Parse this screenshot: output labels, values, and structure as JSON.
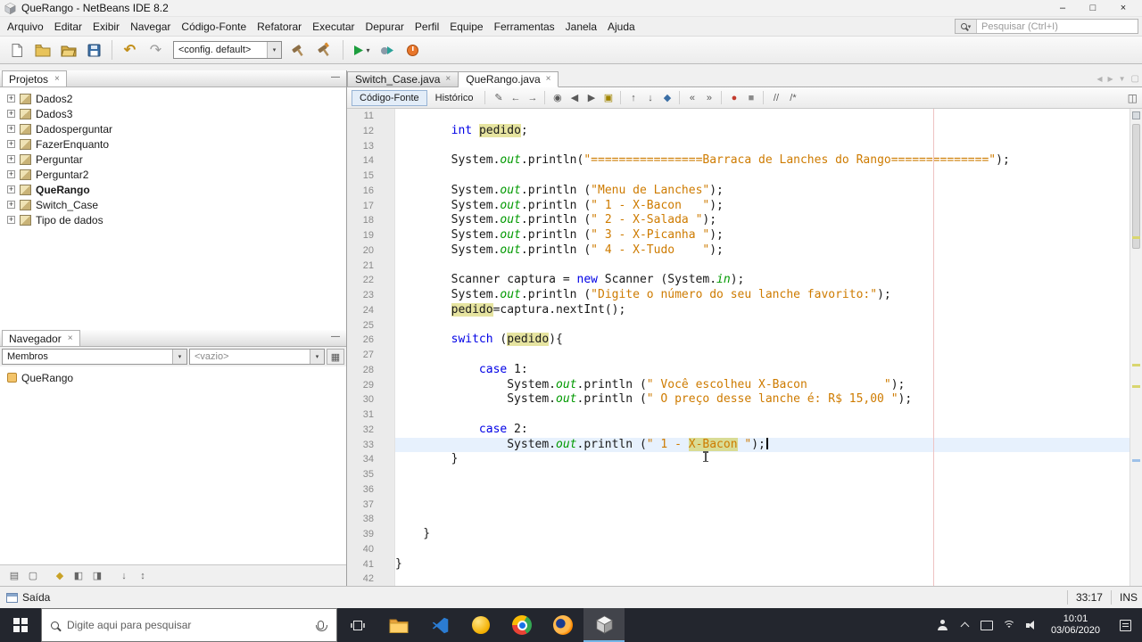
{
  "window": {
    "title": "QueRango - NetBeans IDE 8.2",
    "minimize_glyph": "–",
    "maximize_glyph": "□",
    "close_glyph": "×"
  },
  "icons": {
    "plus": "+",
    "close": "×",
    "minimize_panel": "—",
    "dropdown": "▾",
    "grid": "▦",
    "tab_prev": "◀",
    "tab_next": "▶",
    "tab_list": "▼",
    "tab_max": "▢",
    "undo": "↶",
    "redo": "↷",
    "split": "◫"
  },
  "menubar": [
    "Arquivo",
    "Editar",
    "Exibir",
    "Navegar",
    "Código-Fonte",
    "Refatorar",
    "Executar",
    "Depurar",
    "Perfil",
    "Equipe",
    "Ferramentas",
    "Janela",
    "Ajuda"
  ],
  "quick_search": {
    "placeholder": "Pesquisar (Ctrl+I)"
  },
  "toolbar": {
    "config_value": "<config. default>"
  },
  "projects_panel": {
    "title": "Projetos",
    "items": [
      "Dados2",
      "Dados3",
      "Dadosperguntar",
      "FazerEnquanto",
      "Perguntar",
      "Perguntar2",
      "QueRango",
      "Switch_Case",
      "Tipo de dados"
    ],
    "main_project": "QueRango"
  },
  "navigator_panel": {
    "title": "Navegador",
    "view_value": "Membros",
    "filter_value": "<vazio>",
    "items": [
      "QueRango"
    ],
    "filter_icons": [
      {
        "n": "open-documents-icon",
        "g": "▤"
      },
      {
        "n": "editor-members-icon",
        "g": "▢"
      },
      {
        "sep": true
      },
      {
        "n": "show-inherited-members-icon",
        "g": "◆",
        "c": "#c9a227"
      },
      {
        "n": "show-fields-icon",
        "g": "◧"
      },
      {
        "n": "show-static-members-icon",
        "g": "◨"
      },
      {
        "sep": true
      },
      {
        "n": "sort-by-name-icon",
        "g": "↓"
      },
      {
        "n": "sort-by-source-icon",
        "g": "↕"
      }
    ]
  },
  "editor": {
    "tabs": [
      {
        "label": "Switch_Case.java",
        "active": false
      },
      {
        "label": "QueRango.java",
        "active": true
      }
    ],
    "toolbar": {
      "source_label": "Código-Fonte",
      "history_label": "Histórico",
      "icons": [
        {
          "n": "last-edited-icon",
          "g": "✎"
        },
        {
          "n": "back-icon",
          "g": "←"
        },
        {
          "n": "forward-icon",
          "g": "→"
        },
        {
          "sep": true
        },
        {
          "n": "find-selection-icon",
          "g": "◉"
        },
        {
          "n": "find-previous-occurrence-icon",
          "g": "◀"
        },
        {
          "n": "find-next-occurrence-icon",
          "g": "▶"
        },
        {
          "n": "toggle-highlight-search-icon",
          "g": "▣",
          "c": "#a08400"
        },
        {
          "sep": true
        },
        {
          "n": "previous-bookmark-icon",
          "g": "↑"
        },
        {
          "n": "next-bookmark-icon",
          "g": "↓"
        },
        {
          "n": "toggle-bookmark-icon",
          "g": "◆",
          "c": "#3a6ea5"
        },
        {
          "sep": true
        },
        {
          "n": "shift-left-icon",
          "g": "«"
        },
        {
          "n": "shift-right-icon",
          "g": "»"
        },
        {
          "sep": true
        },
        {
          "n": "start-macro-recording-icon",
          "g": "●",
          "c": "#c23b2e"
        },
        {
          "n": "stop-macro-recording-icon",
          "g": "■",
          "c": "#8a8a8a"
        },
        {
          "sep": true
        },
        {
          "n": "comment-lines-icon",
          "g": "//"
        },
        {
          "n": "uncomment-lines-icon",
          "g": "/*"
        }
      ]
    },
    "first_line_number": 11,
    "current_line": 33,
    "lines": [
      [],
      [
        [
          "",
          "        "
        ],
        [
          "k",
          "int"
        ],
        [
          "",
          " "
        ],
        [
          "o",
          "pedido"
        ],
        [
          "",
          ";"
        ]
      ],
      [],
      [
        [
          "",
          "        System."
        ],
        [
          "f",
          "out"
        ],
        [
          "",
          ".println("
        ],
        [
          "s",
          "\"================Barraca de Lanches do Rango==============\""
        ],
        [
          "",
          ");"
        ]
      ],
      [],
      [
        [
          "",
          "        System."
        ],
        [
          "f",
          "out"
        ],
        [
          "",
          ".println ("
        ],
        [
          "s",
          "\"Menu de Lanches\""
        ],
        [
          "",
          ");"
        ]
      ],
      [
        [
          "",
          "        System."
        ],
        [
          "f",
          "out"
        ],
        [
          "",
          ".println ("
        ],
        [
          "s",
          "\" 1 - X-Bacon   \""
        ],
        [
          "",
          ");"
        ]
      ],
      [
        [
          "",
          "        System."
        ],
        [
          "f",
          "out"
        ],
        [
          "",
          ".println ("
        ],
        [
          "s",
          "\" 2 - X-Salada \""
        ],
        [
          "",
          ");"
        ]
      ],
      [
        [
          "",
          "        System."
        ],
        [
          "f",
          "out"
        ],
        [
          "",
          ".println ("
        ],
        [
          "s",
          "\" 3 - X-Picanha \""
        ],
        [
          "",
          ");"
        ]
      ],
      [
        [
          "",
          "        System."
        ],
        [
          "f",
          "out"
        ],
        [
          "",
          ".println ("
        ],
        [
          "s",
          "\" 4 - X-Tudo    \""
        ],
        [
          "",
          ");"
        ]
      ],
      [],
      [
        [
          "",
          "        Scanner captura = "
        ],
        [
          "k",
          "new"
        ],
        [
          "",
          " Scanner (System."
        ],
        [
          "f",
          "in"
        ],
        [
          "",
          ");"
        ]
      ],
      [
        [
          "",
          "        System."
        ],
        [
          "f",
          "out"
        ],
        [
          "",
          ".println ("
        ],
        [
          "s",
          "\"Digite o número do seu lanche favorito:\""
        ],
        [
          "",
          ");"
        ]
      ],
      [
        [
          "",
          "        "
        ],
        [
          "o",
          "pedido"
        ],
        [
          "",
          "=captura.nextInt();"
        ]
      ],
      [],
      [
        [
          "",
          "        "
        ],
        [
          "k",
          "switch"
        ],
        [
          "",
          " ("
        ],
        [
          "o",
          "pedido"
        ],
        [
          "",
          "){"
        ]
      ],
      [],
      [
        [
          "",
          "            "
        ],
        [
          "k",
          "case"
        ],
        [
          "",
          " 1:"
        ]
      ],
      [
        [
          "",
          "                System."
        ],
        [
          "f",
          "out"
        ],
        [
          "",
          ".println ("
        ],
        [
          "s",
          "\" Você escolheu X-Bacon           \""
        ],
        [
          "",
          ");"
        ]
      ],
      [
        [
          "",
          "                System."
        ],
        [
          "f",
          "out"
        ],
        [
          "",
          ".println ("
        ],
        [
          "s",
          "\" O preço desse lanche é: R$ 15,00 \""
        ],
        [
          "",
          ");"
        ]
      ],
      [],
      [
        [
          "",
          "            "
        ],
        [
          "k",
          "case"
        ],
        [
          "",
          " 2:"
        ]
      ],
      [
        [
          "",
          "                System."
        ],
        [
          "f",
          "out"
        ],
        [
          "",
          ".println ("
        ],
        [
          "s",
          "\" 1 - "
        ],
        [
          "so",
          "X-Bacon"
        ],
        [
          "s",
          " \""
        ],
        [
          "",
          ");"
        ]
      ],
      [
        [
          "",
          "        }"
        ]
      ],
      [],
      [],
      [],
      [],
      [
        [
          "",
          "    }"
        ]
      ],
      [],
      [
        [
          "",
          "}"
        ]
      ],
      []
    ]
  },
  "status_bar": {
    "output_label": "Saída",
    "caret_position": "33:17",
    "insert_mode": "INS"
  },
  "taskbar": {
    "search_placeholder": "Digite aqui para pesquisar",
    "time": "10:01",
    "date": "03/06/2020"
  }
}
